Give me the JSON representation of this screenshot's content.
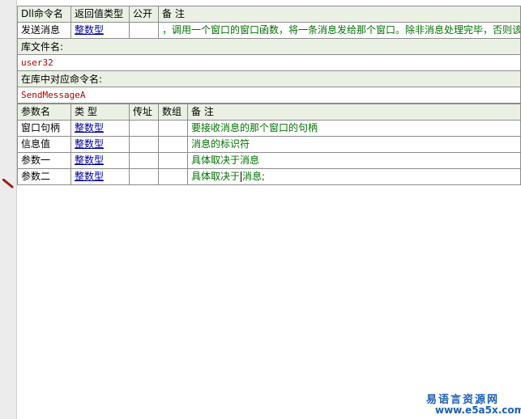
{
  "dll": {
    "headers": [
      "Dll命令名",
      "返回值类型",
      "公开",
      "备 注"
    ],
    "row": {
      "name": "发送消息",
      "return_type": "整数型",
      "public": "",
      "note": "，调用一个窗口的窗口函数，将一条消息发给那个窗口。除非消息处理完毕，否则该"
    }
  },
  "library": {
    "label": "库文件名:",
    "value": "user32"
  },
  "command": {
    "label": "在库中对应命令名:",
    "value": "SendMessageA"
  },
  "params": {
    "headers": [
      "参数名",
      "类 型",
      "传址",
      "数组",
      "备 注"
    ],
    "rows": [
      {
        "name": "窗口句柄",
        "type": "整数型",
        "byref": "",
        "array": "",
        "note": "要接收消息的那个窗口的句柄"
      },
      {
        "name": "信息值",
        "type": "整数型",
        "byref": "",
        "array": "",
        "note": "消息的标识符"
      },
      {
        "name": "参数一",
        "type": "整数型",
        "byref": "",
        "array": "",
        "note": "具体取决于消息"
      },
      {
        "name": "参数二",
        "type": "整数型",
        "byref": "",
        "array": "",
        "note_before_caret": "具体取决于",
        "note_after_caret": "消息;"
      }
    ]
  },
  "watermark": {
    "line1": "易语言资源网",
    "line2": "www.e5a5x.com"
  },
  "colors": {
    "header_bg": "#eaf1e4",
    "note_green": "#007000",
    "link_blue": "#000099",
    "mono_red": "#b00000"
  }
}
